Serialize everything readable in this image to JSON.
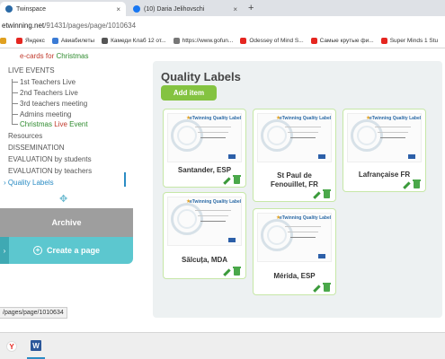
{
  "browser": {
    "tabs": [
      {
        "label": "Twinspace",
        "icon": "twinspace-icon",
        "color": "#2b6aa6"
      },
      {
        "label": "(10) Daria Jelihovschi",
        "icon": "facebook-icon",
        "color": "#1877f2"
      }
    ],
    "address": {
      "domain": "etwinning.net",
      "path": "/91431/pages/page/1010634"
    },
    "bookmarks": [
      {
        "label": "",
        "icon": "app-icon",
        "color": "#e0a020"
      },
      {
        "label": "Яндекс",
        "icon": "yandex-icon",
        "color": "#e52620"
      },
      {
        "label": "Авиабилеты",
        "icon": "plane-icon",
        "color": "#3b7bd5"
      },
      {
        "label": "Камеди Клаб 12 от...",
        "icon": "play-icon",
        "color": "#555"
      },
      {
        "label": "https://www.gofun...",
        "icon": "globe-icon",
        "color": "#777"
      },
      {
        "label": "Odessey of Mind S...",
        "icon": "youtube-icon",
        "color": "#e52620"
      },
      {
        "label": "Самые крутые фи...",
        "icon": "youtube-icon",
        "color": "#e52620"
      },
      {
        "label": "Super Minds 1 Stu",
        "icon": "youtube-icon",
        "color": "#e52620"
      }
    ]
  },
  "sidebar": {
    "items": [
      {
        "label": "e-cards for Christmas",
        "parts": [
          "e-cards for ",
          "Christmas"
        ]
      },
      {
        "label": "LIVE EVENTS"
      },
      {
        "label": "1st Teachers Live"
      },
      {
        "label": "2nd Teachers Live"
      },
      {
        "label": "3rd teachers meeting"
      },
      {
        "label": "Admins meeting"
      },
      {
        "label": "Christmas Live Event",
        "parts": [
          "Christmas ",
          "Live",
          " Event"
        ]
      },
      {
        "label": "Resources"
      },
      {
        "label": "DISSEMINATION"
      },
      {
        "label": "EVALUATION by students"
      },
      {
        "label": "EVALUATION by teachers"
      },
      {
        "label": "Quality Labels",
        "arrow": "›"
      }
    ],
    "move_icon": "✥",
    "archive_label": "Archive",
    "create_label": "Create a page",
    "collapse_arrow": "›"
  },
  "status_url": "/pages/page/1010634",
  "main": {
    "title": "Quality Labels",
    "add_label": "Add item",
    "certificate_heading": "eTwinning Quality Label",
    "cards": [
      {
        "name": "Santander, ESP"
      },
      {
        "name": "St Paul de Fenouillet, FR"
      },
      {
        "name": "Lafrançaise FR"
      },
      {
        "name": "Sălcuța, MDA"
      },
      {
        "name": "Mérida, ESP"
      }
    ]
  },
  "taskbar": {
    "items": [
      {
        "label": "Y",
        "icon": "yandex-icon"
      },
      {
        "label": "W",
        "icon": "word-icon"
      }
    ]
  },
  "colors": {
    "accent": "#2b8cc4",
    "add_button": "#84c341",
    "create": "#5cc7cf",
    "archive": "#9e9e9e"
  }
}
